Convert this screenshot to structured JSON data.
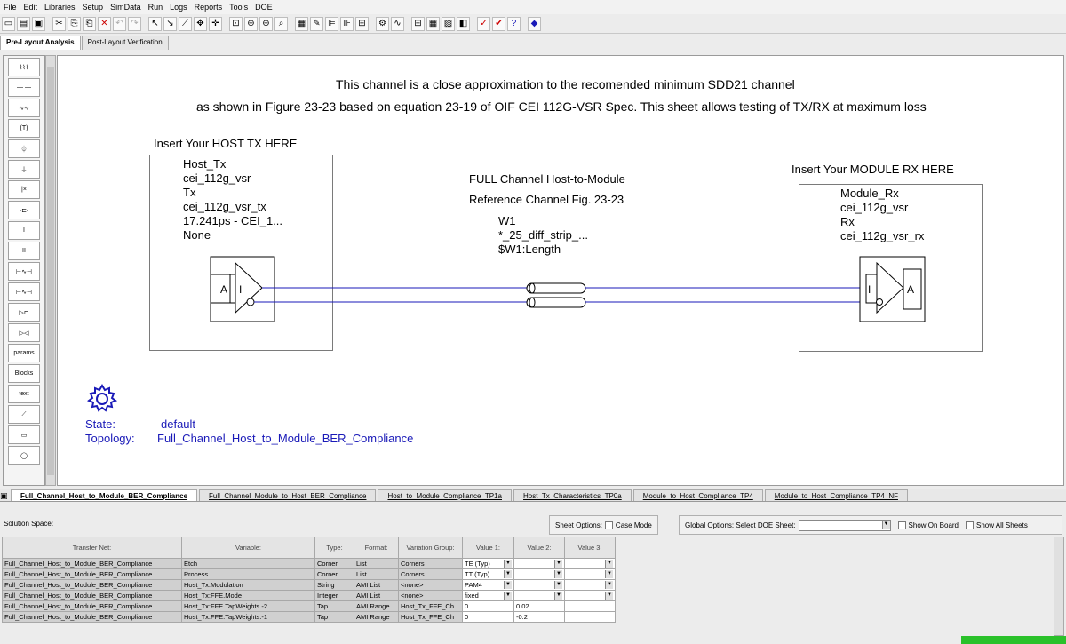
{
  "menu": [
    "File",
    "Edit",
    "Libraries",
    "Setup",
    "SimData",
    "Run",
    "Logs",
    "Reports",
    "Tools",
    "DOE"
  ],
  "top_tabs": [
    "Pre-Layout Analysis",
    "Post-Layout Verification"
  ],
  "palette": {
    "text_label": "text",
    "params_label": "params",
    "blocks_label": "Blocks"
  },
  "banner": {
    "line1": "This channel is a close approximation to the recomended minimum SDD21 channel",
    "line2": "as shown in Figure 23-23 based on equation 23-19 of OIF CEI 112G-VSR Spec. This sheet allows testing of TX/RX at maximum loss"
  },
  "host": {
    "header": "Insert Your HOST TX HERE",
    "lines": [
      "Host_Tx",
      "cei_112g_vsr",
      "Tx",
      "cei_112g_vsr_tx",
      "17.241ps - CEI_1...",
      "None"
    ],
    "pin_a": "A",
    "pin_i": "I"
  },
  "channel": {
    "title1": "FULL Channel Host-to-Module",
    "title2": "Reference Channel Fig. 23-23",
    "lines": [
      "W1",
      "*_25_diff_strip_...",
      "$W1:Length"
    ]
  },
  "module": {
    "header": "Insert Your MODULE RX HERE",
    "lines": [
      "Module_Rx",
      "cei_112g_vsr",
      "Rx",
      "cei_112g_vsr_rx"
    ],
    "pin_a": "A",
    "pin_i": "I"
  },
  "state": {
    "label": "State:",
    "value": "default",
    "topo_label": "Topology:",
    "topo_value": "Full_Channel_Host_to_Module_BER_Compliance"
  },
  "sheet_tabs": [
    "Full_Channel_Host_to_Module_BER_Compliance",
    "Full_Channel_Module_to_Host_BER_Compliance",
    "Host_to_Module_Compliance_TP1a",
    "Host_Tx_Characteristics_TP0a",
    "Module_to_Host_Compliance_TP4",
    "Module_to_Host_Compliance_TP4_NF"
  ],
  "bottom": {
    "solution_space": "Solution Space:",
    "sheet_options": "Sheet Options:",
    "case_mode": "Case Mode",
    "global_options": "Global Options:",
    "select_doe": "Select DOE Sheet:",
    "show_on_board": "Show On Board",
    "show_all_sheets": "Show All Sheets"
  },
  "grid": {
    "headers": [
      "Transfer Net:",
      "Variable:",
      "Type:",
      "Format:",
      "Variation Group:",
      "Value 1:",
      "Value 2:",
      "Value 3:"
    ],
    "rows": [
      [
        "Full_Channel_Host_to_Module_BER_Compliance",
        "Etch",
        "Corner",
        "List",
        "Corners",
        "TE (Typ)",
        "",
        ""
      ],
      [
        "Full_Channel_Host_to_Module_BER_Compliance",
        "Process",
        "Corner",
        "List",
        "Corners",
        "TT (Typ)",
        "",
        ""
      ],
      [
        "Full_Channel_Host_to_Module_BER_Compliance",
        "Host_Tx:Modulation",
        "String",
        "AMI List",
        "<none>",
        "PAM4",
        "",
        ""
      ],
      [
        "Full_Channel_Host_to_Module_BER_Compliance",
        "Host_Tx:FFE.Mode",
        "Integer",
        "AMI List",
        "<none>",
        "fixed",
        "",
        ""
      ],
      [
        "Full_Channel_Host_to_Module_BER_Compliance",
        "Host_Tx:FFE.TapWeights.-2",
        "Tap",
        "AMI Range",
        "Host_Tx_FFE_Ch",
        "0",
        "0.02",
        ""
      ],
      [
        "Full_Channel_Host_to_Module_BER_Compliance",
        "Host_Tx:FFE.TapWeights.-1",
        "Tap",
        "AMI Range",
        "Host_Tx_FFE_Ch",
        "0",
        "-0.2",
        ""
      ]
    ]
  }
}
